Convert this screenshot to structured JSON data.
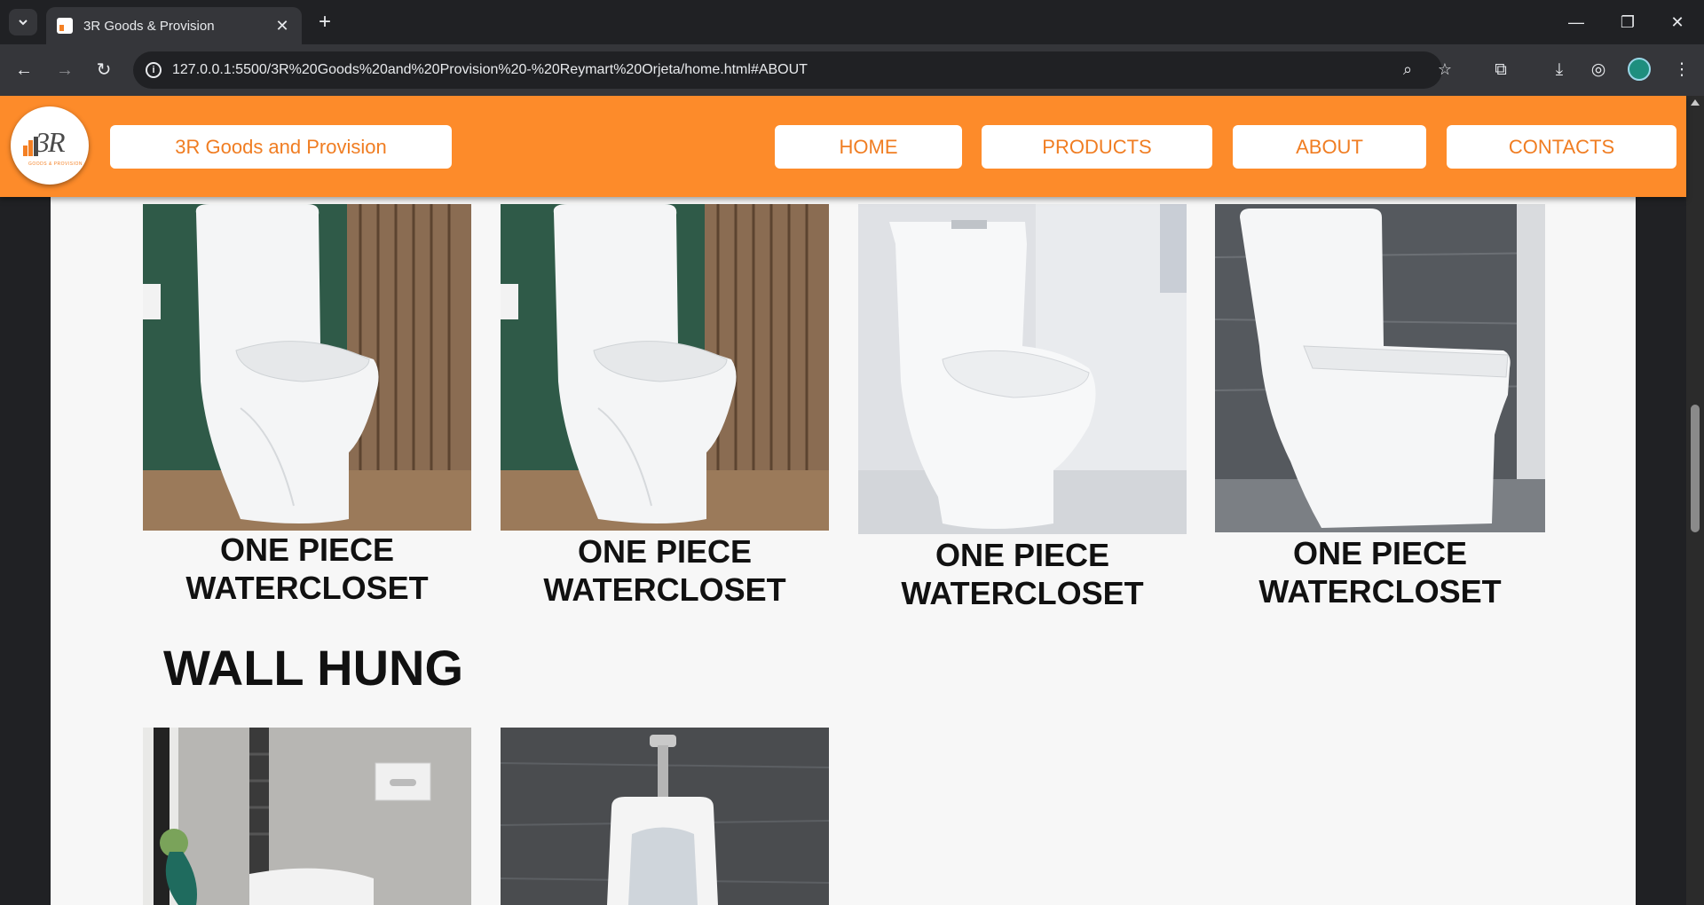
{
  "browser": {
    "tab_title": "3R Goods & Provision",
    "url": "127.0.0.1:5500/3R%20Goods%20and%20Provision%20-%20Reymart%20Orjeta/home.html#ABOUT"
  },
  "site": {
    "logo_text": "3R",
    "logo_subtext": "GOODS & PROVISION",
    "brand": "3R Goods and Provision",
    "nav": [
      "HOME",
      "PRODUCTS",
      "ABOUT",
      "CONTACTS"
    ]
  },
  "products_top": [
    {
      "caption_line1": "ONE PIECE",
      "caption_line2": "WATERCLOSET"
    },
    {
      "caption_line1": "ONE PIECE",
      "caption_line2": "WATERCLOSET"
    },
    {
      "caption_line1": "ONE PIECE",
      "caption_line2": "WATERCLOSET"
    },
    {
      "caption_line1": "ONE PIECE",
      "caption_line2": "WATERCLOSET"
    }
  ],
  "section": {
    "title": "WALL HUNG"
  }
}
